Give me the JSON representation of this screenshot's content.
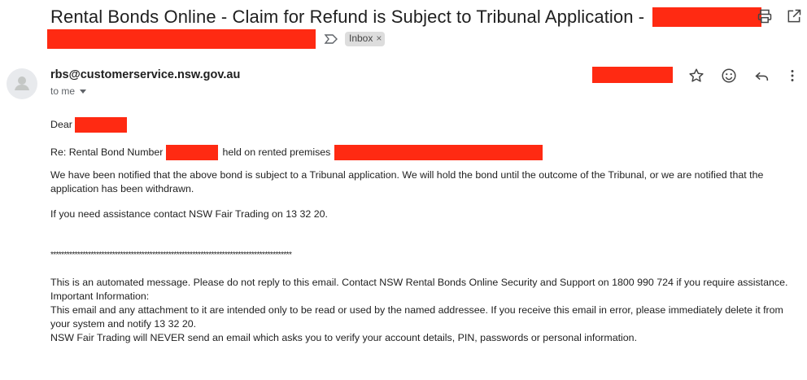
{
  "email": {
    "subject": "Rental Bonds Online - Claim for Refund is Subject to Tribunal Application -",
    "label_chip": "Inbox",
    "label_remove": "×",
    "sender": "rbs@customerservice.nsw.gov.au",
    "recipient": "to me",
    "body": {
      "greeting": "Dear",
      "re_prefix": "Re: Rental Bond Number",
      "re_middle": "held on rented premises",
      "para1": "We have been notified that the above bond is subject to a Tribunal application. We will hold the bond until the outcome of the Tribunal, or we are notified that the application has been withdrawn.",
      "para2": "If you need assistance contact NSW Fair Trading on 13 32 20.",
      "separator": "******************************************************************************************",
      "auto_msg": "This is an automated message. Please do not reply to this email. Contact NSW Rental Bonds Online Security and Support on 1800 990 724 if you require assistance.",
      "important_heading": "Important Information:",
      "important_text": "This email and any attachment to it are intended only to be read or used by the named addressee. If you receive this email in error, please immediately delete it from your system and notify 13 32 20.",
      "never_text": "NSW Fair Trading will NEVER send an email which asks you to verify your account details, PIN, passwords or personal information."
    }
  },
  "icons": {
    "print": "print-icon",
    "popout": "open-in-new-window-icon",
    "important": "importance-marker-icon",
    "star": "star-icon",
    "emoji": "emoji-reaction-icon",
    "reply": "reply-icon",
    "more": "more-vertical-icon",
    "avatar": "default-avatar-icon"
  },
  "colors": {
    "redaction": "#ff2a12"
  }
}
